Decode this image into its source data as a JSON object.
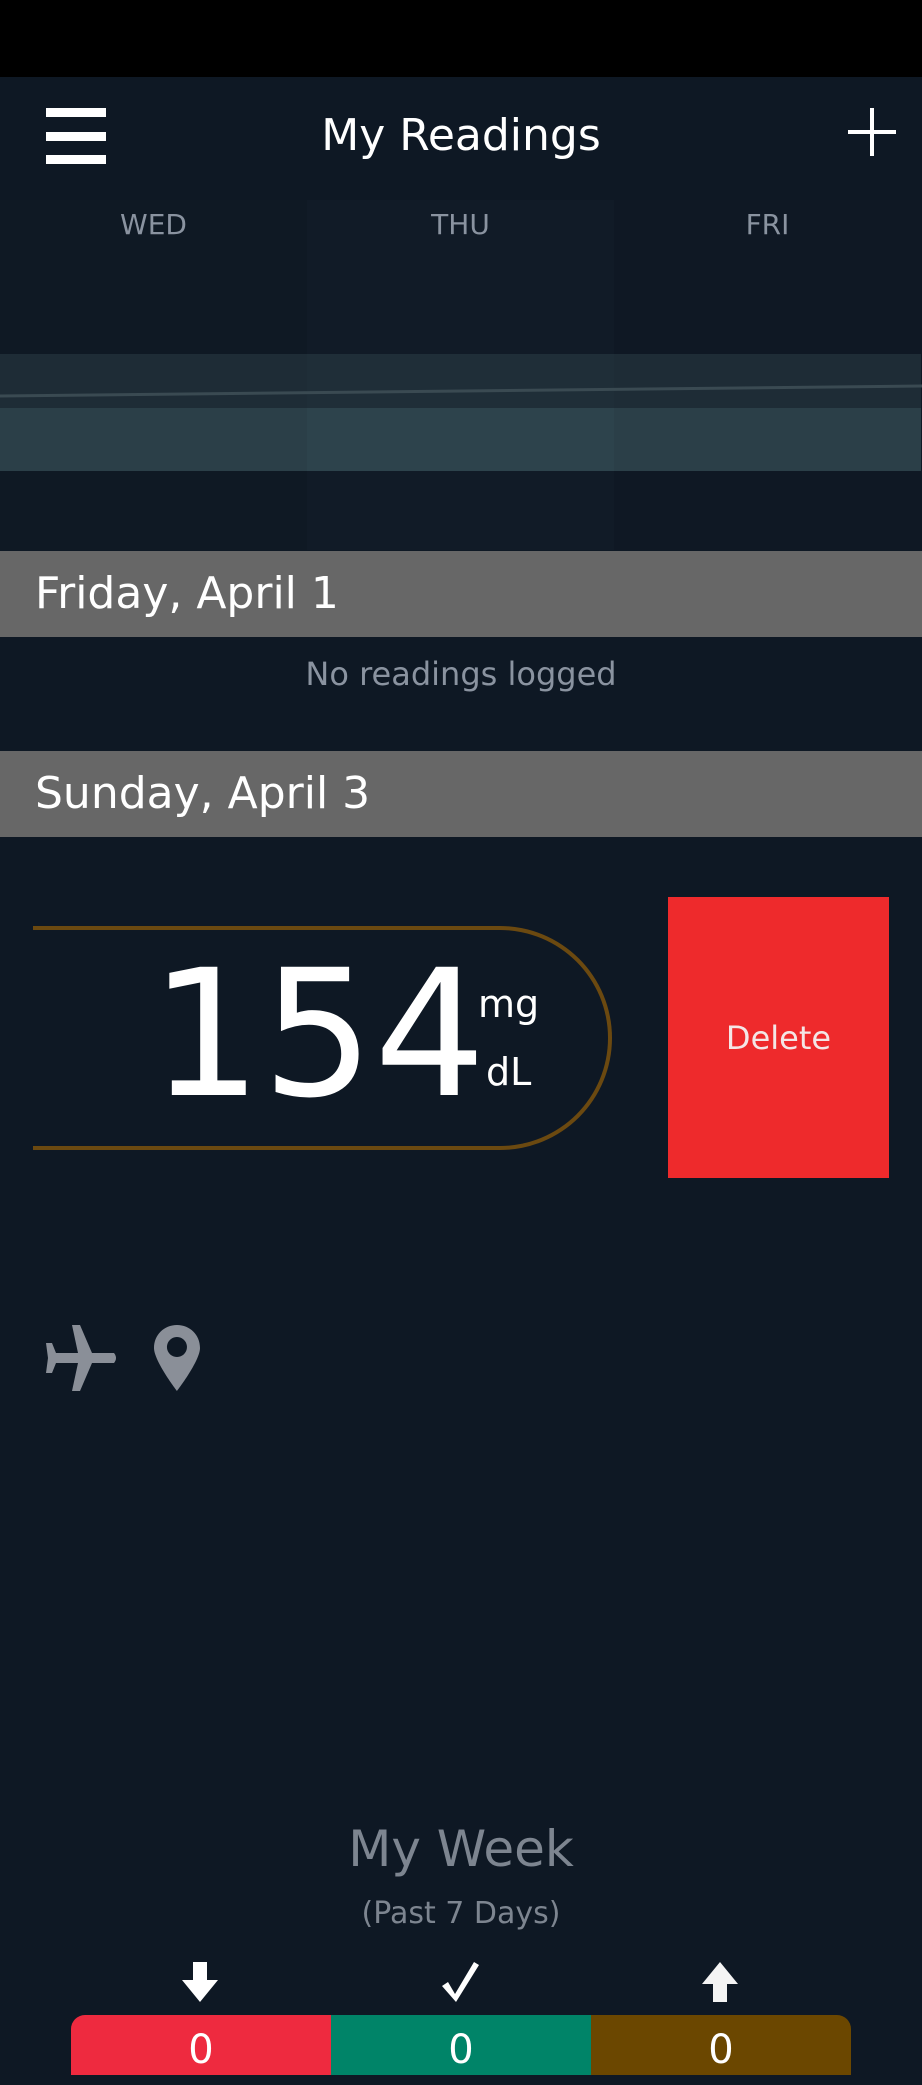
{
  "header": {
    "title": "My Readings",
    "menu_icon": "hamburger-menu-icon",
    "add_icon": "plus-icon"
  },
  "calendar": {
    "days": [
      "WED",
      "THU",
      "FRI"
    ]
  },
  "days": [
    {
      "date": "Friday, April 1",
      "empty_text": "No readings logged"
    },
    {
      "date": "Sunday, April 3",
      "reading": {
        "value": "154",
        "unit_top": "mg",
        "unit_bottom": "dL",
        "border_color": "#6b4910"
      },
      "delete_label": "Delete",
      "tag_icons": [
        "airplane-icon",
        "location-pin-icon"
      ]
    }
  ],
  "week": {
    "title": "My Week",
    "subtitle": "(Past 7 Days)",
    "stats": [
      {
        "icon": "arrow-down-icon",
        "count": "0",
        "color": "#ee2a3f"
      },
      {
        "icon": "check-icon",
        "count": "0",
        "color": "#008468"
      },
      {
        "icon": "arrow-up-icon",
        "count": "0",
        "color": "#6b4700"
      }
    ]
  },
  "colors": {
    "background": "#0e1824",
    "day_header": "#676767",
    "delete": "#ee2a2c"
  }
}
